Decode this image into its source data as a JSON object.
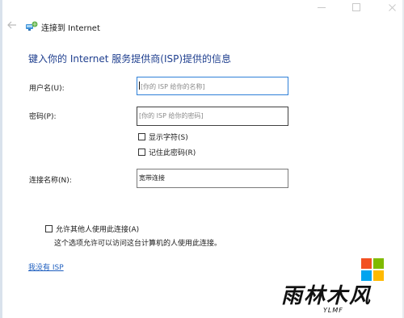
{
  "window": {
    "title": "连接到 Internet"
  },
  "heading": "键入你的 Internet 服务提供商(ISP)提供的信息",
  "form": {
    "username_label": "用户名(U):",
    "username_placeholder": "[你的 ISP 给你的名称]",
    "password_label": "密码(P):",
    "password_placeholder": "[你的 ISP 给你的密码]",
    "show_chars_label": "显示字符(S)",
    "remember_label": "记住此密码(R)",
    "connection_name_label": "连接名称(N):",
    "connection_name_value": "宽带连接",
    "allow_others_label": "允许其他人使用此连接(A)",
    "allow_others_note": "这个选项允许可以访问这台计算机的人使用此连接。"
  },
  "links": {
    "no_isp": "我没有 ISP"
  },
  "watermark": {
    "text": "雨林木风",
    "sub": "YLMF",
    "colors": [
      "#f25022",
      "#7fba00",
      "#00a4ef",
      "#ffb900"
    ]
  },
  "icons": {
    "back": "back-arrow-icon",
    "wizard": "network-connection-icon",
    "minimize": "minimize-icon",
    "maximize": "maximize-icon",
    "close": "close-icon"
  }
}
